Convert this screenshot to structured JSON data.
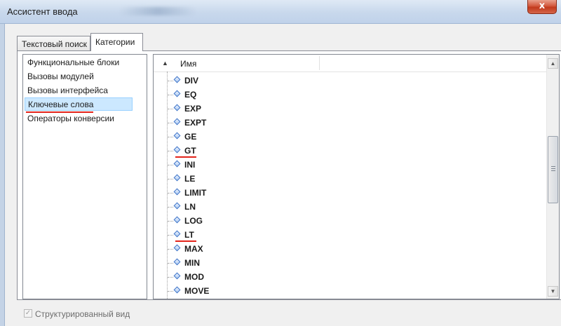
{
  "window": {
    "title": "Ассистент ввода",
    "close_label": "x"
  },
  "tabs": [
    {
      "label": "Текстовый поиск",
      "active": false
    },
    {
      "label": "Категории",
      "active": true
    }
  ],
  "categories": {
    "items": [
      {
        "label": "Функциональные блоки"
      },
      {
        "label": "Вызовы модулей"
      },
      {
        "label": "Вызовы интерфейса"
      },
      {
        "label": "Ключевые слова",
        "selected": true
      },
      {
        "label": "Операторы конверсии"
      }
    ]
  },
  "tree": {
    "column_header": "Имя",
    "sort_indicator": "▲",
    "items": [
      {
        "label": "DIV"
      },
      {
        "label": "EQ"
      },
      {
        "label": "EXP"
      },
      {
        "label": "EXPT"
      },
      {
        "label": "GE"
      },
      {
        "label": "GT",
        "underlined": true
      },
      {
        "label": "INI"
      },
      {
        "label": "LE"
      },
      {
        "label": "LIMIT"
      },
      {
        "label": "LN"
      },
      {
        "label": "LOG"
      },
      {
        "label": "LT",
        "underlined": true
      },
      {
        "label": "MAX"
      },
      {
        "label": "MIN"
      },
      {
        "label": "MOD"
      },
      {
        "label": "MOVE"
      }
    ],
    "item_icon": "diamond-icon"
  },
  "scrollbar": {
    "up_glyph": "▲",
    "down_glyph": "▼",
    "grip_icon": "grip-icon"
  },
  "options": {
    "structured_view_label": "Структурированный вид",
    "structured_view_checked": true,
    "check_glyph": "✓"
  },
  "colors": {
    "selection_bg": "#cce8ff",
    "annotation_red": "#e3241b",
    "icon_blue": "#3b72c8"
  }
}
